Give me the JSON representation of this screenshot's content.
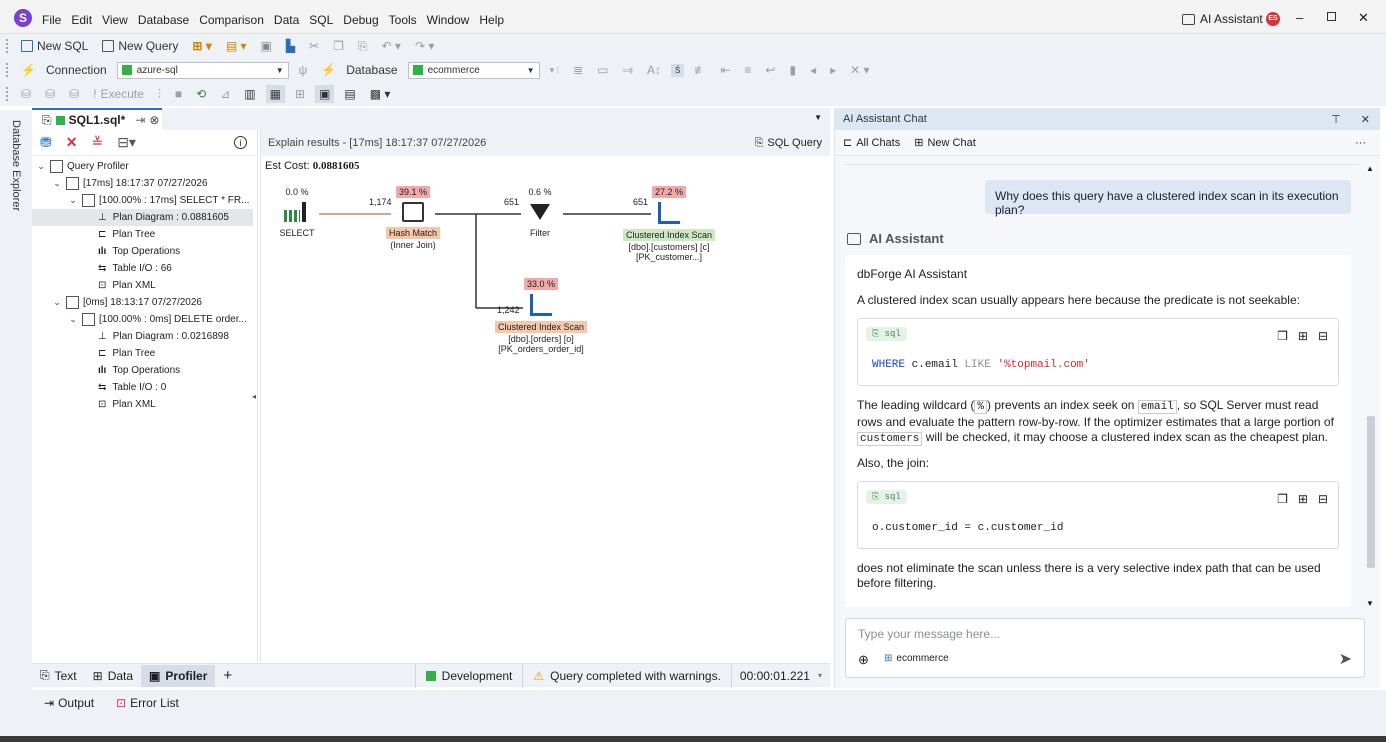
{
  "menu": [
    "File",
    "Edit",
    "View",
    "Database",
    "Comparison",
    "Data",
    "SQL",
    "Debug",
    "Tools",
    "Window",
    "Help"
  ],
  "title_right": {
    "ai_assistant": "AI Assistant",
    "user_initials": "ES"
  },
  "toolbar1": {
    "new_sql": "New SQL",
    "new_query": "New Query"
  },
  "toolbar2": {
    "connection_label": "Connection",
    "connection_value": "azure-sql",
    "database_label": "Database",
    "database_value": "ecommerce"
  },
  "toolbar3": {
    "execute": "Execute"
  },
  "side_tab": "Database Explorer",
  "doc_tab": {
    "label": "SQL1.sql*"
  },
  "tree": {
    "root": "Query Profiler",
    "items": [
      {
        "text": "[17ms] 18:17:37 07/27/2026"
      },
      {
        "text": "[100.00% : 17ms] SELECT * FR..."
      },
      {
        "text": "Plan Diagram : 0.0881605"
      },
      {
        "text": "Plan Tree"
      },
      {
        "text": "Top Operations"
      },
      {
        "text": "Table I/O : 66"
      },
      {
        "text": "Plan XML"
      },
      {
        "text": "[0ms] 18:13:17 07/27/2026"
      },
      {
        "text": "[100.00% : 0ms] DELETE order..."
      },
      {
        "text": "Plan Diagram : 0.0216898"
      },
      {
        "text": "Plan Tree"
      },
      {
        "text": "Top Operations"
      },
      {
        "text": "Table I/O : 0"
      },
      {
        "text": "Plan XML"
      }
    ]
  },
  "explain": {
    "header": "Explain results - [17ms] 18:17:37 07/27/2026",
    "sql_query": "SQL Query",
    "est_cost_label": "Est Cost:",
    "est_cost_value": "0.0881605",
    "nodes": {
      "select": {
        "pct": "0.0 %",
        "label": "SELECT"
      },
      "hash": {
        "pct": "39.1 %",
        "label": "Hash Match",
        "sub": "(Inner Join)"
      },
      "filter": {
        "pct": "0.6 %",
        "label": "Filter"
      },
      "cis1": {
        "pct": "27.2 %",
        "label": "Clustered Index Scan",
        "sub1": "[dbo].[customers] [c]",
        "sub2": "[PK_customer...]"
      },
      "cis2": {
        "pct": "33.0 %",
        "label": "Clustered Index Scan",
        "sub1": "[dbo].[orders] [o]",
        "sub2": "[PK_orders_order_id]"
      }
    },
    "rows": {
      "select_hash": "1,174",
      "hash_filter": "651",
      "filter_cis": "651",
      "hash_cis2": "1,242"
    }
  },
  "bottom_tabs": {
    "text": "Text",
    "data": "Data",
    "profiler": "Profiler",
    "add": "+"
  },
  "status": {
    "env": "Development",
    "warning": "Query completed with warnings.",
    "time": "00:00:01.221"
  },
  "output_bar": {
    "output": "Output",
    "errors": "Error List"
  },
  "chat": {
    "title": "AI Assistant Chat",
    "all_chats": "All Chats",
    "new_chat": "New Chat",
    "user_msg": "Why does this query have a clustered index scan in its execution plan?",
    "assistant_name": "AI Assistant",
    "bot_title": "dbForge AI Assistant",
    "p1": "A clustered index scan usually appears here because the predicate is not seekable:",
    "code1": {
      "kw": "WHERE",
      "a": "c.email",
      "op": "LIKE",
      "str": "'%topmail.com'"
    },
    "sql_chip": "sql",
    "p2a": "The leading wildcard (",
    "p2code1": "%",
    "p2b": ") prevents an index seek on ",
    "p2code2": "email",
    "p2c": ", so SQL Server must read rows and evaluate the pattern row-by-row. If the optimizer estimates that a large portion of ",
    "p2code3": "customers",
    "p2d": " will be checked, it may choose a clustered index scan as the cheapest plan.",
    "p3": "Also, the join:",
    "code2": "o.customer_id = c.customer_id",
    "p4": "does not eliminate the scan unless there is a very selective index path that can be used before filtering.",
    "input_placeholder": "Type your message here...",
    "context_db": "ecommerce"
  },
  "colors": {
    "accent_blue": "#1e6fd9",
    "title_bar": "#f3f3f3",
    "panel_header": "#dde6f3",
    "select_green": "#2fb344"
  }
}
